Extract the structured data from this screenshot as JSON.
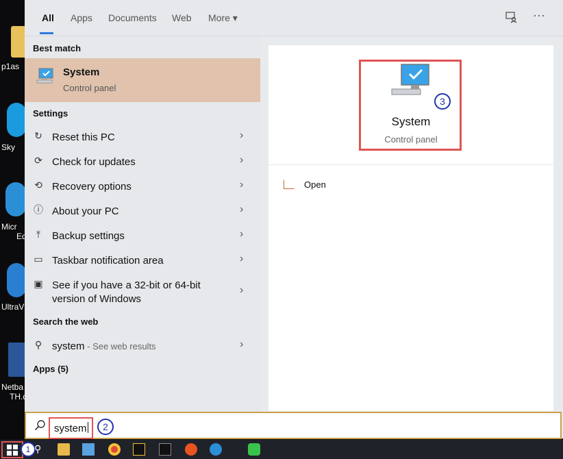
{
  "desktop": {
    "labels": [
      "p1as",
      "Sky",
      "Micr",
      "Ed",
      "UltraV",
      "Netba",
      "TH.d"
    ]
  },
  "tabs": {
    "all": "All",
    "apps": "Apps",
    "documents": "Documents",
    "web": "Web",
    "more": "More ▾",
    "feedback_icon": "feedback-icon",
    "options": "···"
  },
  "left": {
    "best_match_heading": "Best match",
    "best_match": {
      "title": "System",
      "subtitle": "Control panel"
    },
    "settings_heading": "Settings",
    "settings": [
      {
        "icon": "reset-icon",
        "label": "Reset this PC"
      },
      {
        "icon": "update-icon",
        "label": "Check for updates"
      },
      {
        "icon": "recovery-icon",
        "label": "Recovery options"
      },
      {
        "icon": "info-icon",
        "label": "About your PC"
      },
      {
        "icon": "backup-icon",
        "label": "Backup settings"
      },
      {
        "icon": "taskbar-icon",
        "label": "Taskbar notification area"
      },
      {
        "icon": "laptop-icon",
        "label": "See if you have a 32-bit or 64-bit version of Windows"
      }
    ],
    "search_web_heading": "Search the web",
    "web_result": {
      "query": "system",
      "suffix": " - See web results"
    },
    "apps_heading": "Apps (5)"
  },
  "preview": {
    "title": "System",
    "subtitle": "Control panel",
    "step": "3",
    "open_label": "Open"
  },
  "search": {
    "value": "system",
    "step": "2"
  },
  "taskbar": {
    "start_step": "1",
    "colors": {
      "accent": "#2b7bd8",
      "highlight_border": "#e05452",
      "best_match_bg": "#e0c2ad"
    }
  }
}
